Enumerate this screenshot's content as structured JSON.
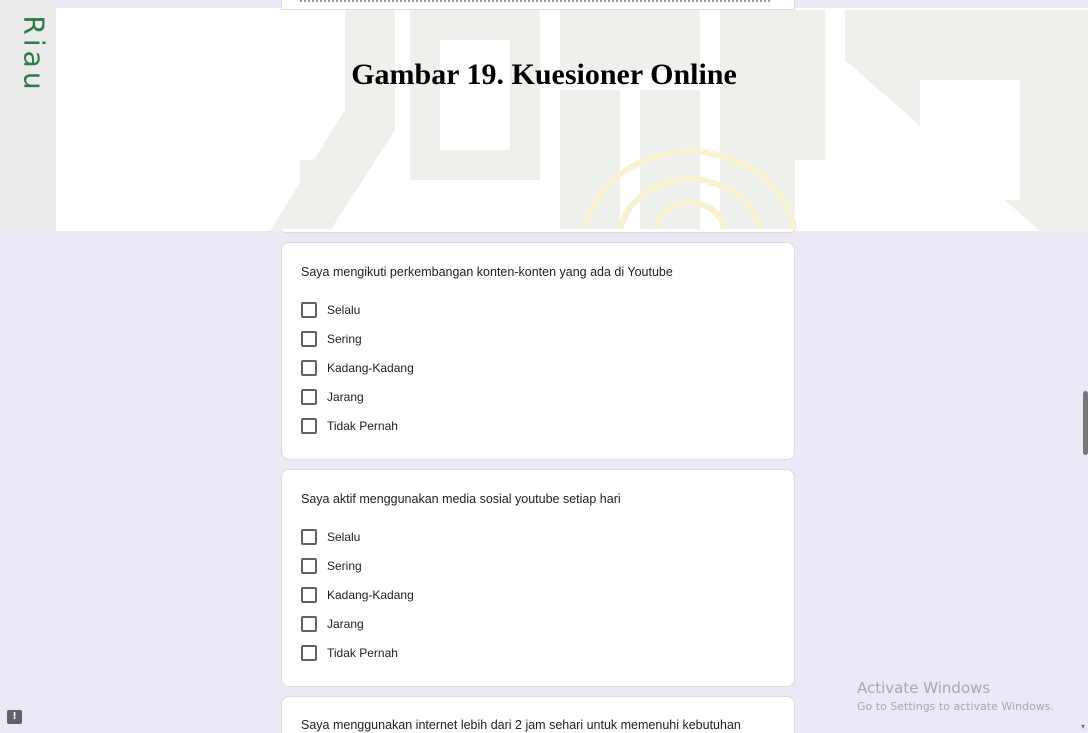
{
  "document": {
    "side_text": "Riau",
    "caption": "Gambar 19. Kuesioner Online"
  },
  "questions": [
    {
      "title": "Saya mengikuti perkembangan konten-konten yang ada di Youtube",
      "options": [
        "Selalu",
        "Sering",
        "Kadang-Kadang",
        "Jarang",
        "Tidak Pernah"
      ]
    },
    {
      "title": "Saya aktif menggunakan media sosial youtube setiap hari",
      "options": [
        "Selalu",
        "Sering",
        "Kadang-Kadang",
        "Jarang",
        "Tidak Pernah"
      ]
    },
    {
      "title": "Saya menggunakan internet lebih dari 2 jam sehari untuk memenuhi kebutuhan"
    }
  ],
  "activation": {
    "title": "Activate Windows",
    "subtitle": "Go to Settings to activate Windows."
  },
  "feedback_icon": "report-icon",
  "colors": {
    "page_bg": "#ece8f6",
    "card_border": "#dadce0",
    "riau_text": "#2d7a4a",
    "checkbox_border": "#5f6368"
  }
}
